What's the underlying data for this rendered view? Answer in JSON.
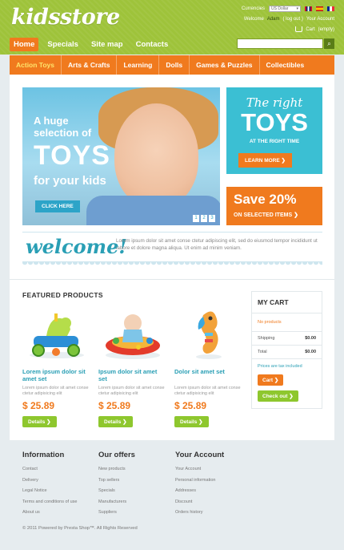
{
  "header": {
    "logo": "kidsstore",
    "currencies_label": "Currencies",
    "currency_value": "US Dollar",
    "welcome_text": "Welcome",
    "username": "Adam",
    "logout": "( log out )",
    "your_account": "Your Account",
    "cart_label": "Cart",
    "cart_status": "(empty)",
    "nav": [
      "Home",
      "Specials",
      "Site map",
      "Contacts"
    ],
    "search_placeholder": ""
  },
  "categories": [
    "Action Toys",
    "Arts & Crafts",
    "Learning",
    "Dolls",
    "Games & Puzzles",
    "Collectibles"
  ],
  "banner": {
    "line1": "A huge selection of",
    "line2": "TOYS",
    "line3": "for your kids",
    "button": "CLICK HERE",
    "slides": [
      "1",
      "2",
      "3"
    ]
  },
  "promo_top": {
    "line1": "The right",
    "line2": "TOYS",
    "line3": "AT THE RIGHT TIME",
    "button": "LEARN MORE"
  },
  "promo_bottom": {
    "line1": "Save 20%",
    "line2": "ON SELECTED ITEMS"
  },
  "welcome": {
    "title": "welcome!",
    "text": "Lorem ipsum dolor sit amet conse ctetur adipiscing elit, sed do eiusmod tempor incididunt ut labore et dolore magna aliqua. Ut enim ad minim veniam."
  },
  "featured": {
    "title": "FEATURED PRODUCTS",
    "products": [
      {
        "name": "Lorem ipsum dolor sit amet set",
        "desc": "Lorem ipsum dolor sit amet conse ctetur adipisicing elit",
        "price": "$ 25.89",
        "button": "Details"
      },
      {
        "name": "Ipsum dolor sit amet set",
        "desc": "Lorem ipsum dolor sit amet conse ctetur adipisicing elit",
        "price": "$ 25.89",
        "button": "Details"
      },
      {
        "name": "Dolor sit amet set",
        "desc": "Lorem ipsum dolor sit amet conse ctetur adipisicing elit",
        "price": "$ 25.89",
        "button": "Details"
      }
    ]
  },
  "cart": {
    "title": "MY CART",
    "empty": "No products",
    "shipping_label": "Shipping",
    "shipping_value": "$0.00",
    "total_label": "Total",
    "total_value": "$0.00",
    "tax_note": "Prices are tax included",
    "cart_button": "Cart",
    "checkout_button": "Check out"
  },
  "footer": {
    "information": {
      "title": "Information",
      "links": [
        "Contact",
        "Delivery",
        "Legal Notice",
        "Terms and conditions of use",
        "About us"
      ]
    },
    "offers": {
      "title": "Our offers",
      "links": [
        "New products",
        "Top sellers",
        "Specials",
        "Manufacturers",
        "Suppliers"
      ]
    },
    "account": {
      "title": "Your Account",
      "links": [
        "Your Account",
        "Personal information",
        "Addresses",
        "Discount",
        "Orders history"
      ]
    },
    "copyright": "© 2011 Powered by Presta Shop™. All Rights Reserved"
  },
  "colors": {
    "green": "#9ec33a",
    "orange": "#f07a1e",
    "teal": "#2a9fb5",
    "cyan": "#3bbfd3"
  }
}
